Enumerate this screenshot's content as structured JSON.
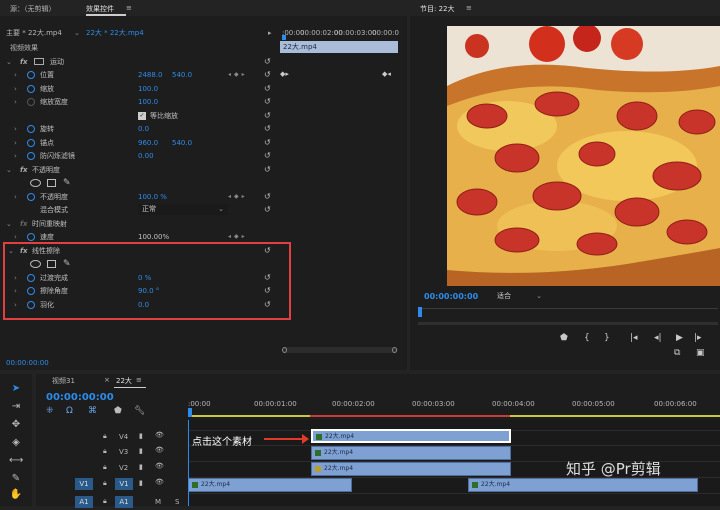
{
  "source_panel": {
    "tab_source": "源：（无剪辑）",
    "tab_effects": "效果控件",
    "menu_glyph": "≡"
  },
  "effects": {
    "master_label": "主要 * 22大.mp4",
    "sequence_label": "22大 * 22大.mp4",
    "timecodes": [
      ":00:00",
      "00:00:02:00",
      "00:00:03:00",
      "00:00:0"
    ],
    "clip_bar": "22大.mp4",
    "section_video": "视频效果",
    "motion": {
      "name": "运动",
      "position": {
        "label": "位置",
        "x": "2488.0",
        "y": "540.0"
      },
      "scale": {
        "label": "缩放",
        "value": "100.0"
      },
      "scale_width": {
        "label": "缩放宽度",
        "value": "100.0"
      },
      "uniform": "等比缩放",
      "rotation": {
        "label": "旋转",
        "value": "0.0"
      },
      "anchor": {
        "label": "锚点",
        "x": "960.0",
        "y": "540.0"
      },
      "flicker": {
        "label": "防闪烁滤镜",
        "value": "0.00"
      }
    },
    "opacity": {
      "name": "不透明度",
      "opacity": {
        "label": "不透明度",
        "value": "100.0 %"
      },
      "blend": {
        "label": "混合模式",
        "value": "正常"
      }
    },
    "time_remap": {
      "name": "时间重映射",
      "speed": {
        "label": "速度",
        "value": "100.00%"
      }
    },
    "linear_wipe": {
      "name": "线性擦除",
      "completion": {
        "label": "过渡完成",
        "value": "0 %"
      },
      "angle": {
        "label": "擦除角度",
        "value": "90.0 °"
      },
      "feather": {
        "label": "羽化",
        "value": "0.0"
      }
    },
    "bottom_time": "00:00:00:00"
  },
  "program": {
    "title": "节目: 22大",
    "menu_glyph": "≡",
    "timecode": "00:00:00:00",
    "fit": "适合",
    "end_time": "00:00:"
  },
  "timeline": {
    "tab_project": "视频31",
    "tab_seq": "22大",
    "timecode": "00:00:00:00",
    "ruler": [
      ":00:00",
      "00:00:01:00",
      "00:00:02:00",
      "00:00:03:00",
      "00:00:04:00",
      "00:00:05:00",
      "00:00:06:00"
    ],
    "tracks": [
      "V4",
      "V3",
      "V2",
      "V1",
      "A1"
    ],
    "clip_name": "22大.mp4",
    "annotation": "点击这个素材",
    "audio_flags": [
      "M",
      "S"
    ]
  },
  "watermark": "知乎 @Pr剪辑",
  "colors": {
    "accent": "#2d8ceb",
    "highlight_box": "#e04040",
    "clip": "#7ea0d2",
    "playhead": "#2d8ceb"
  }
}
